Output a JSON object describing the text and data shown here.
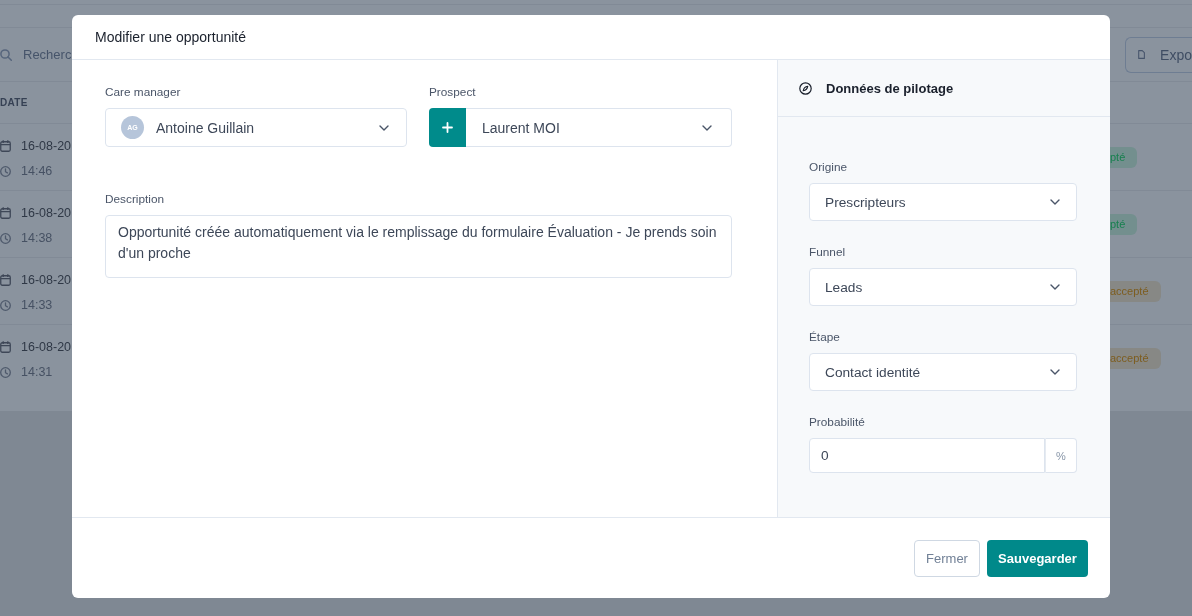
{
  "background_page": {
    "search": {
      "placeholder": "Recherc"
    },
    "export_button": {
      "label": "Expo"
    },
    "table": {
      "columns": [
        "DATE"
      ],
      "rows": [
        {
          "date": "16-08-20",
          "time": "14:46",
          "status": {
            "label": "pté",
            "color": "#17804f"
          }
        },
        {
          "date": "16-08-20",
          "time": "14:38",
          "status": {
            "label": "pté",
            "color": "#17804f"
          }
        },
        {
          "date": "16-08-20",
          "time": "14:33",
          "status": {
            "label": "accepté",
            "color": "#7d5d1f"
          }
        },
        {
          "date": "16-08-20",
          "time": "14:31",
          "status": {
            "label": "accepté",
            "color": "#7d5d1f"
          }
        }
      ]
    }
  },
  "modal": {
    "title": "Modifier une opportunité",
    "care_manager": {
      "label": "Care manager",
      "avatar_initials": "AG",
      "value": "Antoine Guillain"
    },
    "prospect": {
      "label": "Prospect",
      "value": "Laurent MOI"
    },
    "description": {
      "label": "Description",
      "value": "Opportunité créée automatiquement via le remplissage du formulaire Évaluation - Je prends soin d'un proche"
    },
    "pilot_panel": {
      "title": "Données de pilotage",
      "fields": [
        {
          "kind": "select",
          "label": "Origine",
          "value": "Prescripteurs"
        },
        {
          "kind": "select",
          "label": "Funnel",
          "value": "Leads"
        },
        {
          "kind": "select",
          "label": "Étape",
          "value": "Contact identité"
        },
        {
          "kind": "number",
          "label": "Probabilité",
          "value": "0",
          "unit": "%"
        }
      ]
    },
    "buttons": [
      {
        "label": "Fermer",
        "kind": "secondary"
      },
      {
        "label": "Sauvegarder",
        "kind": "primary"
      }
    ]
  }
}
